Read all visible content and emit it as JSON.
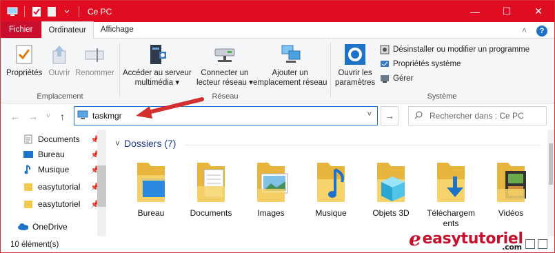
{
  "window": {
    "title": "Ce PC",
    "minimize": "—",
    "maximize": "☐",
    "close": "✕"
  },
  "tabs": {
    "file": "Fichier",
    "computer": "Ordinateur",
    "view": "Affichage"
  },
  "ribbon": {
    "location": {
      "label": "Emplacement",
      "properties": "Propriétés",
      "open": "Ouvrir",
      "rename": "Renommer"
    },
    "network": {
      "label": "Réseau",
      "media_line1": "Accéder au serveur",
      "media_line2": "multimédia",
      "map_line1": "Connecter un",
      "map_line2": "lecteur réseau",
      "add_line1": "Ajouter un",
      "add_line2": "emplacement réseau"
    },
    "system": {
      "label": "Système",
      "settings_line1": "Ouvrir les",
      "settings_line2": "paramètres",
      "uninstall": "Désinstaller ou modifier un programme",
      "sysprops": "Propriétés système",
      "manage": "Gérer"
    }
  },
  "address": {
    "value": "taskmgr",
    "search_placeholder": "Rechercher dans : Ce PC"
  },
  "nav": {
    "items": [
      {
        "label": "Documents",
        "icon": "documents-icon"
      },
      {
        "label": "Bureau",
        "icon": "desktop-icon"
      },
      {
        "label": "Musique",
        "icon": "music-icon"
      },
      {
        "label": "easytutorial",
        "icon": "folder-icon"
      },
      {
        "label": "easytutoriel",
        "icon": "folder-icon"
      }
    ],
    "onedrive": "OneDrive"
  },
  "main": {
    "section_title": "Dossiers (7)",
    "folders": [
      {
        "label": "Bureau"
      },
      {
        "label": "Documents"
      },
      {
        "label": "Images"
      },
      {
        "label": "Musique"
      },
      {
        "label": "Objets 3D"
      },
      {
        "label": "Téléchargem ents"
      },
      {
        "label": "Vidéos"
      }
    ]
  },
  "status": {
    "count": "10 élément(s)"
  },
  "brand": {
    "name": "easytutoriel",
    "suffix": ".com"
  },
  "colors": {
    "titlebar": "#e00d22",
    "accent": "#1e73c9",
    "folder": "#f2c94c"
  }
}
